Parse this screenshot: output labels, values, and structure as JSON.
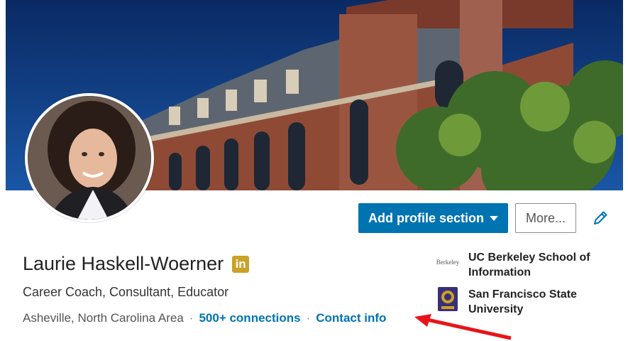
{
  "profile": {
    "name": "Laurie Haskell-Woerner",
    "headline": "Career Coach, Consultant, Educator",
    "location": "Asheville, North Carolina Area",
    "connections": "500+ connections",
    "contact": "Contact info",
    "separator": "·"
  },
  "badge": {
    "text": "in",
    "color": "#c9a227"
  },
  "actions": {
    "add_section": "Add profile section",
    "more": "More...",
    "edit_icon": "pencil-icon"
  },
  "education": [
    {
      "name": "UC Berkeley School of Information",
      "logo": "berkeley-logo",
      "logo_text": "Berkeley"
    },
    {
      "name": "San Francisco State University",
      "logo": "sfsu-seal"
    }
  ],
  "colors": {
    "primary": "#0073b1",
    "annotation_arrow": "#e8141a"
  }
}
